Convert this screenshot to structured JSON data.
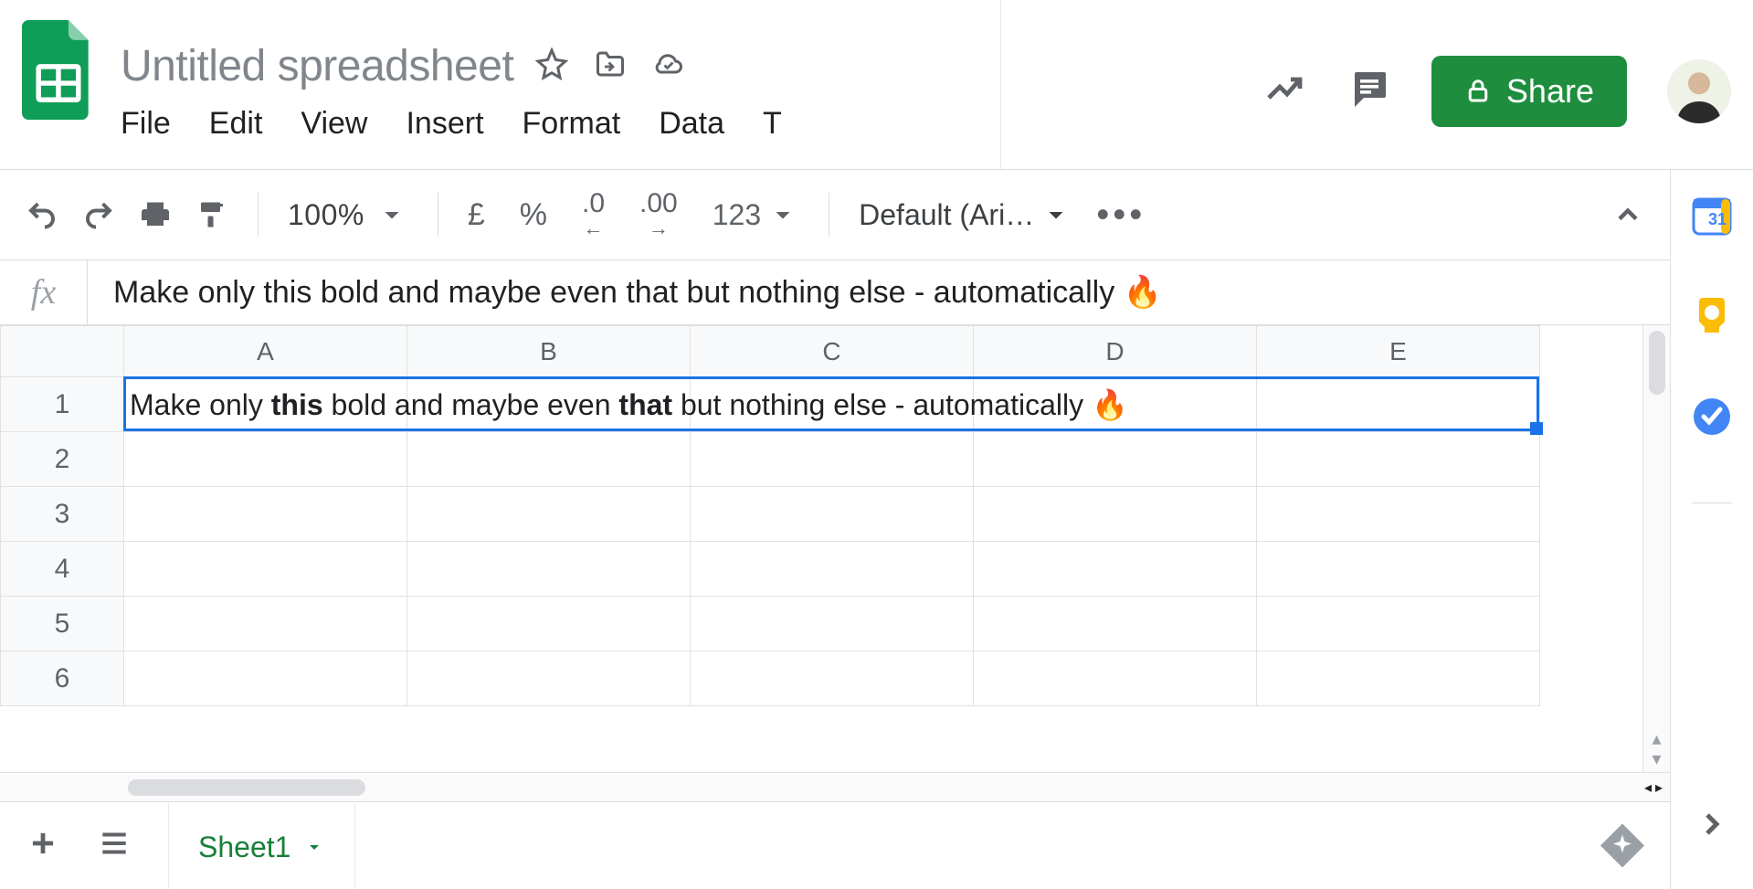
{
  "doc": {
    "title": "Untitled spreadsheet"
  },
  "menus": [
    "File",
    "Edit",
    "View",
    "Insert",
    "Format",
    "Data",
    "T"
  ],
  "header": {
    "share_label": "Share"
  },
  "toolbar": {
    "zoom": "100%",
    "currency": "£",
    "percent": "%",
    "dec_less": ".0",
    "dec_more": ".00",
    "num_fmt": "123",
    "font": "Default (Ari…"
  },
  "formula_bar": {
    "fx_label": "fx",
    "content": "Make only this bold and maybe even that but nothing else - automatically 🔥"
  },
  "grid": {
    "columns": [
      "A",
      "B",
      "C",
      "D",
      "E"
    ],
    "rows": [
      "1",
      "2",
      "3",
      "4",
      "5",
      "6"
    ],
    "selected": "A1",
    "cell_A1_runs": [
      {
        "t": "Make only ",
        "b": false
      },
      {
        "t": "this",
        "b": true
      },
      {
        "t": " bold and maybe even ",
        "b": false
      },
      {
        "t": "that",
        "b": true
      },
      {
        "t": " but nothing else - automatically 🔥",
        "b": false
      }
    ]
  },
  "sheets": {
    "active": "Sheet1"
  },
  "colors": {
    "share_green": "#1e8e3e",
    "tab_green": "#188038",
    "selection_blue": "#1a73e8"
  }
}
